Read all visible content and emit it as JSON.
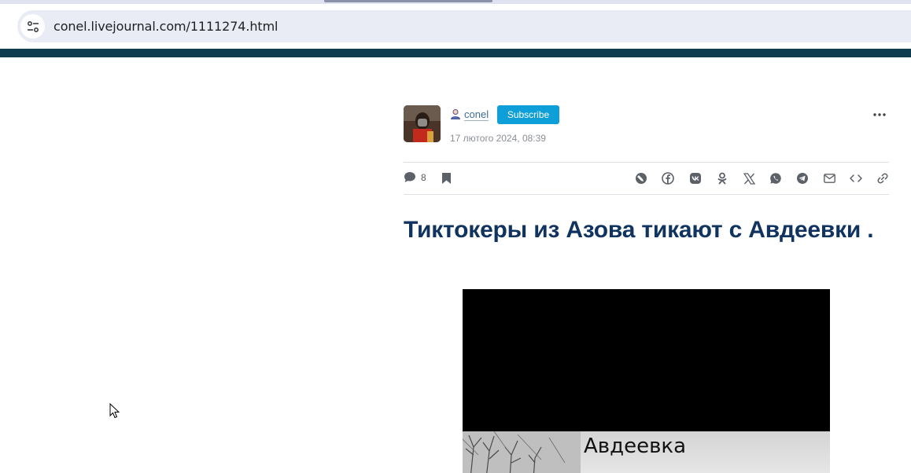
{
  "browser": {
    "url": "conel.livejournal.com/1111274.html",
    "site_info_icon": "tune-icon"
  },
  "post": {
    "author": "conel",
    "subscribe_label": "Subscribe",
    "date": "17 лютого 2024, 08:39",
    "comment_count": "8",
    "title": "Тиктокеры из Азова тикают с Авдеевки .",
    "video_caption": "Авдеевка"
  },
  "share_icons": [
    "livejournal-icon",
    "facebook-icon",
    "vk-icon",
    "odnoklassniki-icon",
    "x-icon",
    "whatsapp-icon",
    "telegram-icon",
    "email-icon",
    "embed-icon",
    "link-icon"
  ],
  "colors": {
    "header_bar": "#0f3d4f",
    "subscribe": "#0f9fd8",
    "title": "#10335f",
    "username": "#3d6e98"
  }
}
